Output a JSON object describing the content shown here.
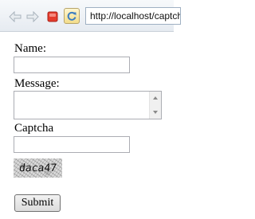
{
  "browser": {
    "url": "http://localhost/captcha"
  },
  "form": {
    "name_label": "Name:",
    "name_value": "",
    "message_label": "Message:",
    "message_value": "",
    "captcha_label": "Captcha",
    "captcha_value": "",
    "captcha_text": "daca47",
    "submit_label": "Submit"
  },
  "colors": {
    "stop_red": "#e53b2c",
    "reload_accent": "#f3dd8a"
  },
  "icons": [
    "back-arrow-icon",
    "forward-arrow-icon",
    "stop-icon",
    "reload-icon"
  ]
}
